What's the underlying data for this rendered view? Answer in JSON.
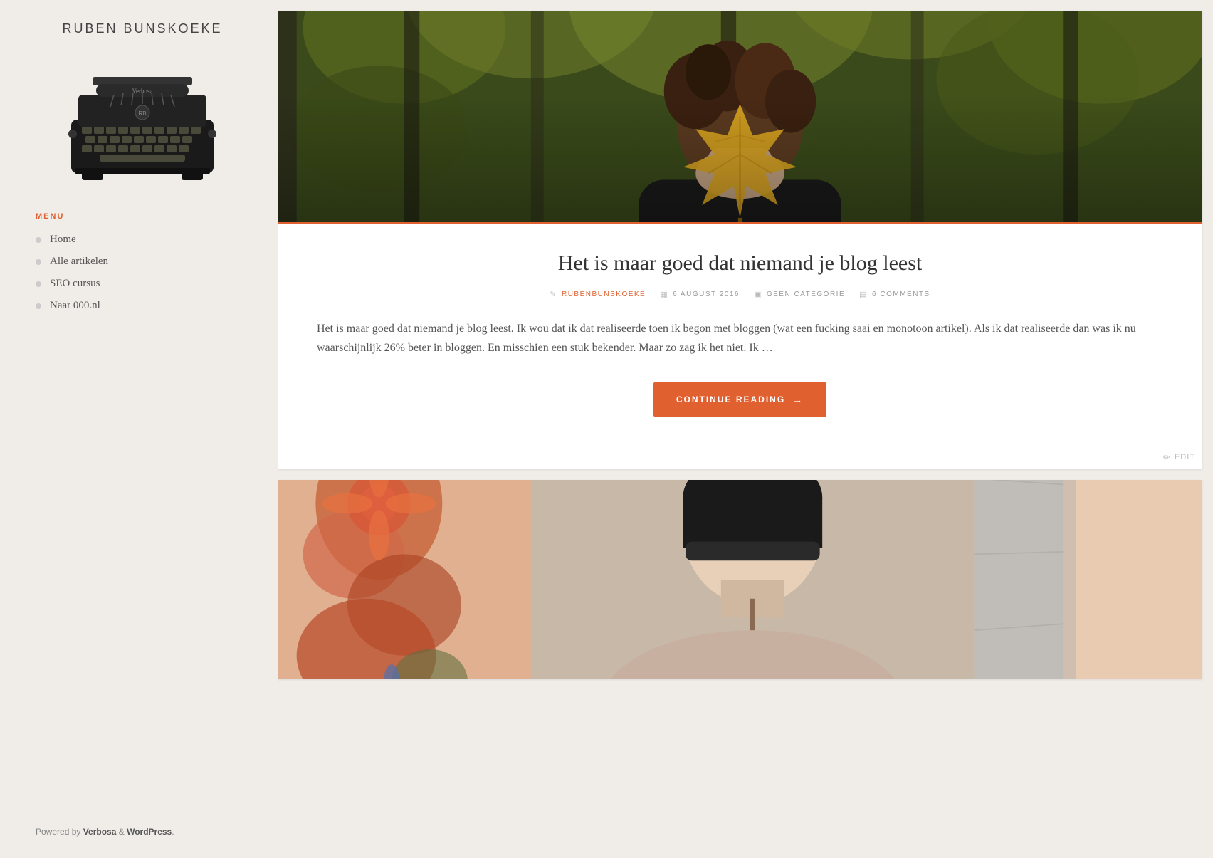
{
  "sidebar": {
    "site_title": "RUBEN BUNSKOEKE",
    "menu_label": "MENU",
    "nav_items": [
      {
        "label": "Home",
        "href": "#"
      },
      {
        "label": "Alle artikelen",
        "href": "#"
      },
      {
        "label": "SEO cursus",
        "href": "#"
      },
      {
        "label": "Naar 000.nl",
        "href": "#"
      }
    ],
    "powered_by_prefix": "Powered by ",
    "powered_by_theme": "Verbosa",
    "powered_by_middle": " & ",
    "powered_by_cms": "WordPress",
    "powered_by_suffix": "."
  },
  "posts": [
    {
      "title": "Het is maar goed dat niemand je blog leest",
      "meta": {
        "author": "RUBENBUNSKOEKE",
        "date": "6 AUGUST 2016",
        "category": "GEEN CATEGORIE",
        "comments": "6 COMMENTS"
      },
      "excerpt": "Het is maar goed dat niemand je blog leest. Ik wou dat ik dat realiseerde toen ik begon met bloggen (wat een fucking saai en monotoon artikel). Als ik dat realiseerde dan was ik nu waarschijnlijk 26% beter in bloggen. En misschien een stuk bekender. Maar zo zag ik het niet. Ik …",
      "continue_reading_label": "CONTINUE READING",
      "edit_label": "EDIT"
    }
  ],
  "icons": {
    "author": "✎",
    "date": "📅",
    "category": "🏷",
    "comments": "💬",
    "arrow": "→",
    "pencil": "✏",
    "edit": "✏"
  },
  "colors": {
    "accent": "#e06030",
    "text_primary": "#333",
    "text_secondary": "#555",
    "text_muted": "#999",
    "background": "#f0ece8",
    "white": "#ffffff"
  }
}
